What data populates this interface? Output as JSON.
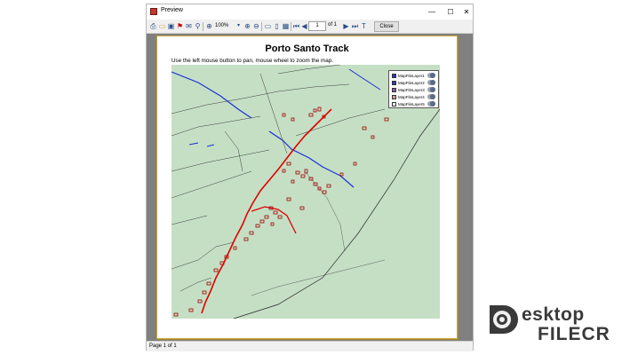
{
  "window": {
    "title": "Preview",
    "controls": {
      "minimize": "—",
      "maximize": "☐",
      "close": "✕"
    }
  },
  "toolbar": {
    "zoom_value": "100%",
    "page_current": "1",
    "page_total_text": "of 1",
    "close_label": "Close",
    "icons": [
      "print-icon",
      "open-icon",
      "save-icon",
      "pdf-icon",
      "email-icon",
      "find-icon",
      "zoom-icon",
      "zoom-in-icon",
      "zoom-out-icon",
      "page-width-icon",
      "whole-page-icon",
      "multi-page-icon",
      "first-page-icon",
      "prev-page-icon",
      "next-page-icon",
      "last-page-icon",
      "edit-text-icon"
    ]
  },
  "document": {
    "title": "Porto Santo Track",
    "instruction": "Use the left mouse button to pan, mouse wheel to zoom the map."
  },
  "legend": {
    "items": [
      {
        "label": "MapFileLayer1",
        "color": "#3333cc"
      },
      {
        "label": "MapFileLayer2",
        "color": "#2b3fa8"
      },
      {
        "label": "MapFileLayer3",
        "color": "#8a5aa8"
      },
      {
        "label": "MapFileLayer4",
        "color": "#c8a0a0"
      },
      {
        "label": "MapFileLayer5",
        "color": "#ffffff"
      }
    ]
  },
  "status": {
    "text": "Page 1 of 1"
  },
  "watermark": {
    "line1": "esktop",
    "line2": "FILECR"
  },
  "colors": {
    "map_land": "#c5dfc5",
    "roads": "#3c3c3c",
    "water": "#1a2fd6",
    "track": "#e00000",
    "buildings": "#a00000"
  }
}
